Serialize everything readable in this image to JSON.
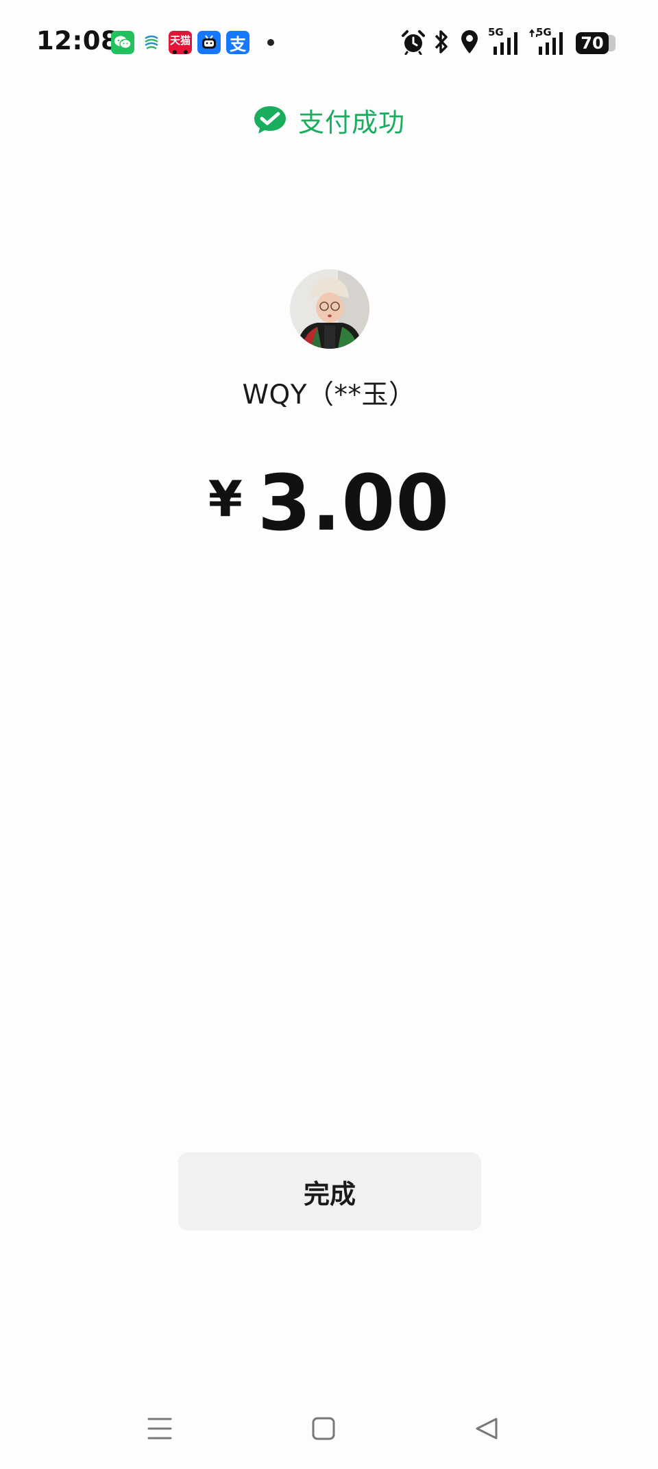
{
  "status_bar": {
    "time": "12:08",
    "notification_icons": [
      "wechat-icon",
      "china-mobile-icon",
      "tmall-icon",
      "bilibili-icon",
      "alipay-icon"
    ],
    "tmall_label": "天猫",
    "alipay_label": "支",
    "system_icons": [
      "alarm-icon",
      "bluetooth-icon",
      "location-icon",
      "signal-5g-icon",
      "signal-5g-icon"
    ],
    "network_label_1": "5G",
    "network_label_2": "5G",
    "battery_level": "70"
  },
  "header": {
    "title": "支付成功",
    "icon": "wechat-pay-check-icon",
    "accent_color": "#1aad5e"
  },
  "payee": {
    "name": "WQY（**玉）"
  },
  "payment": {
    "currency_symbol": "¥",
    "amount": "3.00"
  },
  "actions": {
    "done_label": "完成"
  },
  "nav_bar": {
    "icons": [
      "menu-icon",
      "home-icon",
      "back-icon"
    ]
  }
}
